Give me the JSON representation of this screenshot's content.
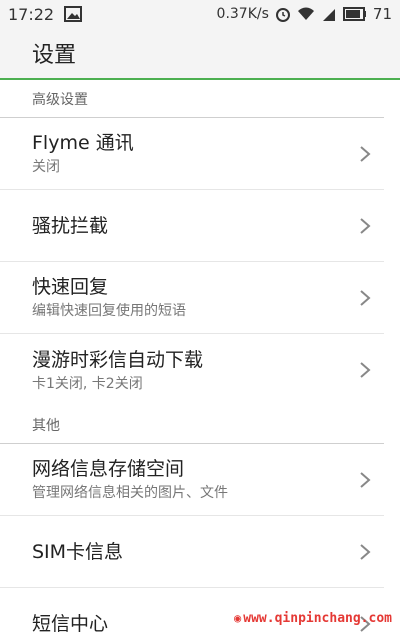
{
  "status_bar": {
    "time": "17:22",
    "speed": "0.37K/s",
    "battery": "71",
    "icons": [
      "image-icon",
      "alarm-icon",
      "wifi-icon",
      "4g-signal-icon",
      "battery-icon"
    ]
  },
  "app_bar": {
    "title": "设置"
  },
  "sections": [
    {
      "header": "高级设置",
      "items": [
        {
          "title": "Flyme 通讯",
          "subtitle": "关闭"
        },
        {
          "title": "骚扰拦截",
          "subtitle": ""
        },
        {
          "title": "快速回复",
          "subtitle": "编辑快速回复使用的短语"
        },
        {
          "title": "漫游时彩信自动下载",
          "subtitle": "卡1关闭, 卡2关闭"
        }
      ]
    },
    {
      "header": "其他",
      "items": [
        {
          "title": "网络信息存储空间",
          "subtitle": "管理网络信息相关的图片、文件"
        },
        {
          "title": "SIM卡信息",
          "subtitle": ""
        },
        {
          "title": "短信中心",
          "subtitle": ""
        }
      ]
    }
  ],
  "watermark": "www.qinpinchang.com",
  "colors": {
    "accent": "#4caf50",
    "watermark": "#e53935"
  }
}
